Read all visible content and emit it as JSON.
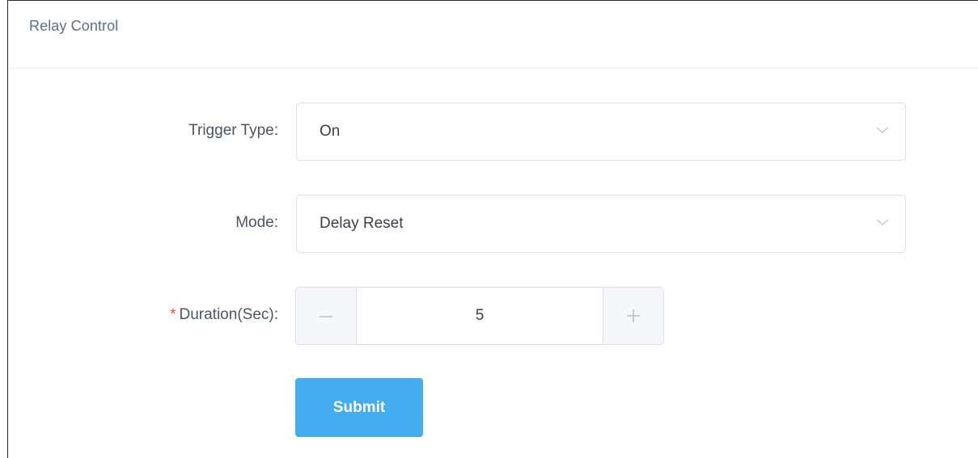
{
  "panel": {
    "title": "Relay Control"
  },
  "form": {
    "trigger_type": {
      "label": "Trigger Type:",
      "value": "On"
    },
    "mode": {
      "label": "Mode:",
      "value": "Delay Reset"
    },
    "duration": {
      "required_mark": "*",
      "label": "Duration(Sec):",
      "value": "5"
    },
    "submit_label": "Submit"
  },
  "colors": {
    "accent": "#45acf0",
    "required": "#f04b4b",
    "title": "#5f7088"
  },
  "icons": {
    "select_arrow": "chevron-down-icon",
    "decrement": "minus-icon",
    "increment": "plus-icon"
  }
}
